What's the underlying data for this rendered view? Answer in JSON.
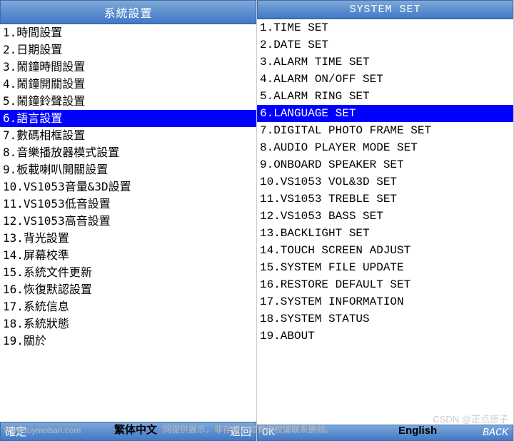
{
  "left": {
    "title": "系統設置",
    "items": [
      "1.時間設置",
      "2.日期設置",
      "3.鬧鐘時間設置",
      "4.鬧鐘開關設置",
      "5.鬧鐘鈴聲設置",
      "6.語言設置",
      "7.數碼相框設置",
      "8.音樂播放器模式設置",
      "9.板載喇叭開關設置",
      "10.VS1053音量&3D設置",
      "11.VS1053低音設置",
      "12.VS1053高音設置",
      "13.背光設置",
      "14.屏幕校準",
      "15.系統文件更新",
      "16.恢復默認設置",
      "17.系統信息",
      "18.系統狀態",
      "19.關於"
    ],
    "footer_left": "確定",
    "footer_right": "返回",
    "caption": "繁体中文"
  },
  "right": {
    "title": "SYSTEM SET",
    "items": [
      "1.TIME SET",
      "2.DATE SET",
      "3.ALARM TIME SET",
      "4.ALARM ON/OFF SET",
      "5.ALARM RING SET",
      "6.LANGUAGE SET",
      "7.DIGITAL PHOTO FRAME SET",
      "8.AUDIO PLAYER MODE SET",
      "9.ONBOARD SPEAKER SET",
      "10.VS1053 VOL&3D SET",
      "11.VS1053 TREBLE SET",
      "12.VS1053 BASS SET",
      "13.BACKLIGHT SET",
      "14.TOUCH SCREEN ADJUST",
      "15.SYSTEM FILE UPDATE",
      "16.RESTORE DEFAULT SET",
      "17.SYSTEM INFORMATION",
      "18.SYSTEM STATUS",
      "19.ABOUT"
    ],
    "footer_left": "OK",
    "footer_right": "BACK",
    "caption": "English"
  },
  "selected_index": 5,
  "watermark_url": "www.toymoban.com",
  "watermark_note": "网提供展示，非存储，如有侵权请联系删除。",
  "watermark_credit": "CSDN @正点原子"
}
